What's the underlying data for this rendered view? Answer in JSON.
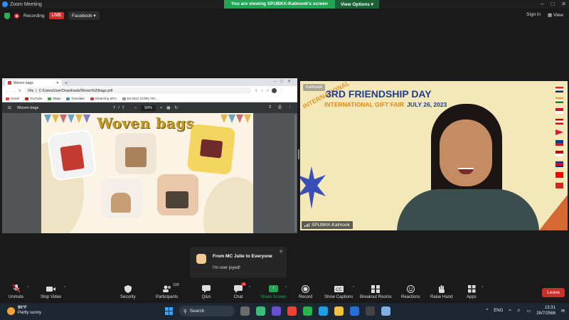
{
  "window": {
    "title": "Zoom Meeting"
  },
  "share_banner": {
    "message": "You are viewing SPUBKK-Kalmook's screen",
    "options_label": "View Options"
  },
  "topbar": {
    "recording_label": "Recording",
    "live_label": "LIVE",
    "stream_target": "Facebook",
    "signin_label": "Sign in",
    "view_label": "View"
  },
  "browser": {
    "tab_title": "Woven bags",
    "address": "C:/Users/User/Downloads/Woven%20bags.pdf",
    "file_label": "File",
    "bookmarks": [
      "Gmail",
      "YouTube",
      "Maps",
      "Translate",
      "Elearning SPU",
      "ผล 2022 SCNN / Eri..."
    ],
    "pdf_title": "Woven bags",
    "page_current": "7",
    "page_total": "7",
    "zoom": "50%"
  },
  "slide": {
    "title": "Woven bags"
  },
  "speaker": {
    "name": "SPUBKK-Kalmook",
    "top_label": "Kalmook",
    "banner_intl": "INTERNATIONAL",
    "banner_title": "3RD FRIENDSHIP DAY",
    "banner_sub": "INTERNATIONAL GIFT FAIR",
    "banner_date": "JULY 26, 2023"
  },
  "chat_toast": {
    "from": "From MC Julie to Everyone",
    "message": "I'm over joyed!"
  },
  "toolbar": {
    "unmute": "Unmute",
    "stop_video": "Stop Video",
    "security": "Security",
    "participants": "Participants",
    "participants_count": "100",
    "qa": "Q&A",
    "chat": "Chat",
    "chat_badge": "4",
    "share_screen": "Share Screen",
    "record": "Record",
    "show_captions": "Show Captions",
    "breakout_rooms": "Breakout Rooms",
    "reactions": "Reactions",
    "raise_hand": "Raise Hand",
    "apps": "Apps",
    "leave": "Leave"
  },
  "taskbar": {
    "temperature": "90°F",
    "weather": "Partly sunny",
    "search_label": "Search",
    "language": "ENG",
    "time": "13:31",
    "date": "26/7/2566"
  },
  "colors": {
    "zoom_blue": "#2d8cff",
    "share_green": "#23a455",
    "live_red": "#e02828",
    "leave_red": "#c9302c"
  }
}
